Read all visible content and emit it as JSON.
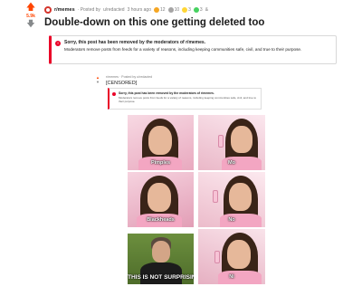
{
  "post": {
    "score": "5.9k",
    "subreddit": "r/memes",
    "posted_by": "Posted by u/",
    "username": "u/redacted",
    "time_ago": "3 hours ago",
    "awards": [
      {
        "count": "12",
        "color": "#f5a623"
      },
      {
        "count": "10",
        "color": "#a5a4a4"
      },
      {
        "count": "3",
        "color": "#ffd635"
      },
      {
        "count": "3",
        "color": "#46d160"
      }
    ],
    "awards_more": "&",
    "title": "Double-down on this one getting deleted too"
  },
  "removal_notice": {
    "title": "Sorry, this post has been removed by the moderators of r/memes.",
    "body": "Moderators remove posts from feeds for a variety of reasons, including keeping communities safe, civil, and true to their purpose."
  },
  "embedded": {
    "score": "vote",
    "meta": "r/memes · Posted by u/redacted",
    "title": "[CENSORED]",
    "notice_title": "Sorry, this post has been removed by the moderators of r/memes.",
    "notice_body": "Moderators remove posts from feeds for a variety of reasons, including keeping communities safe, civil, and true to their purpose."
  },
  "meme": {
    "captions": [
      "Pimples",
      "Mo",
      "Blackheads",
      "No",
      "Ni",
      "THIS IS NOT SURPRISING"
    ]
  },
  "colors": {
    "accent": "#ff4500",
    "removed": "#ea0027"
  }
}
